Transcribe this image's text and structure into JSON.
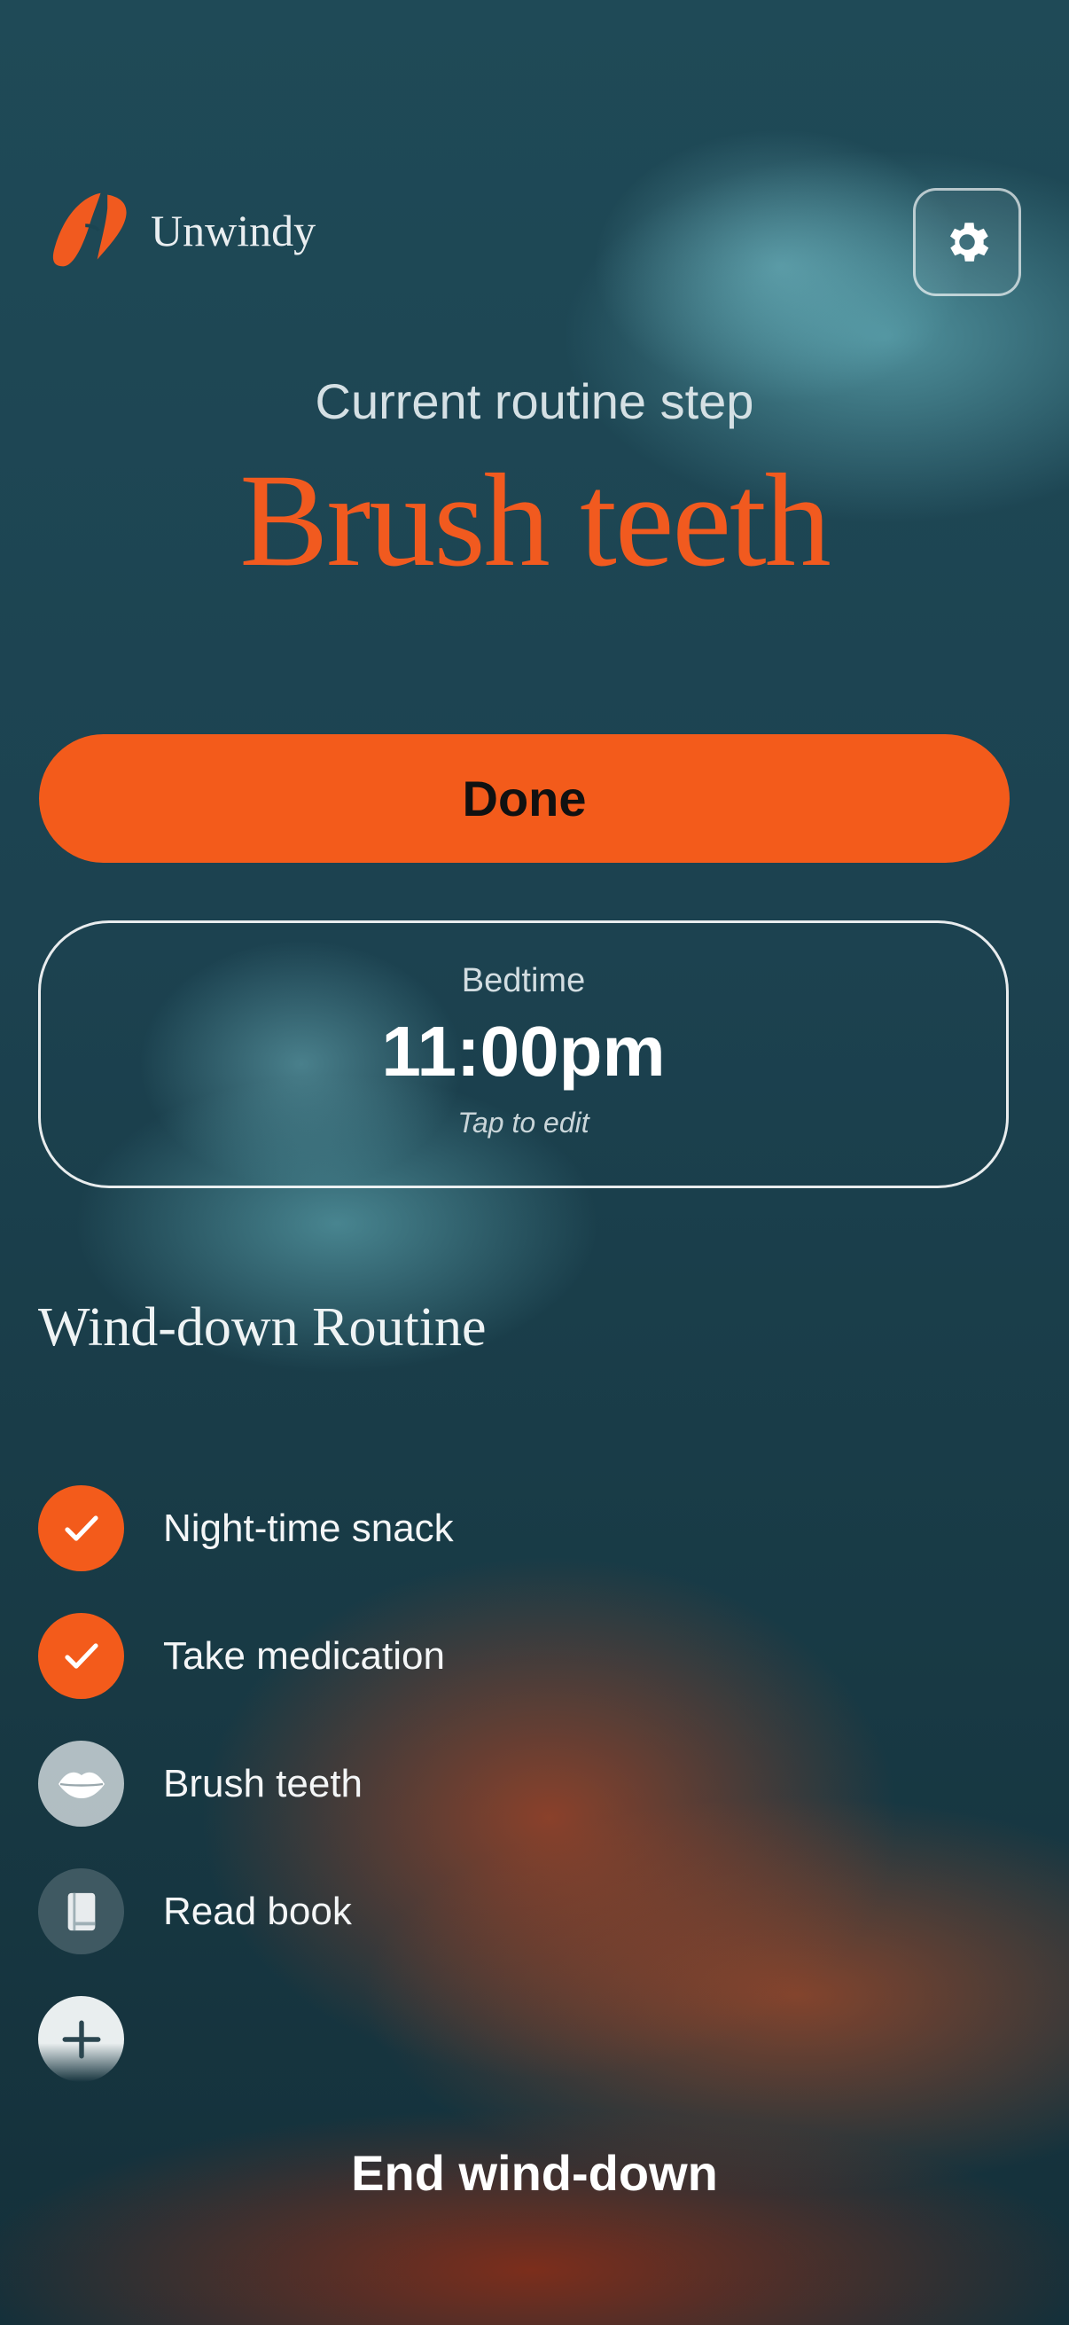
{
  "app": {
    "name": "Unwindy"
  },
  "header": {
    "logo_text": "Unwindy",
    "settings_icon": "gear-icon"
  },
  "current": {
    "label": "Current routine step",
    "step": "Brush teeth"
  },
  "actions": {
    "done_label": "Done",
    "end_label": "End wind-down"
  },
  "bedtime": {
    "label": "Bedtime",
    "time": "11:00pm",
    "hint": "Tap to edit"
  },
  "routine": {
    "title": "Wind-down Routine",
    "items": [
      {
        "label": "Night-time snack",
        "icon": "checkmark-icon",
        "status": "done"
      },
      {
        "label": "Take medication",
        "icon": "checkmark-icon",
        "status": "done"
      },
      {
        "label": "Brush teeth",
        "icon": "lips-icon",
        "status": "current"
      },
      {
        "label": "Read book",
        "icon": "book-icon",
        "status": "pending"
      }
    ],
    "add_icon": "plus-icon"
  },
  "colors": {
    "accent": "#f35b1b",
    "background": "#1b4552",
    "text": "#ffffff"
  }
}
